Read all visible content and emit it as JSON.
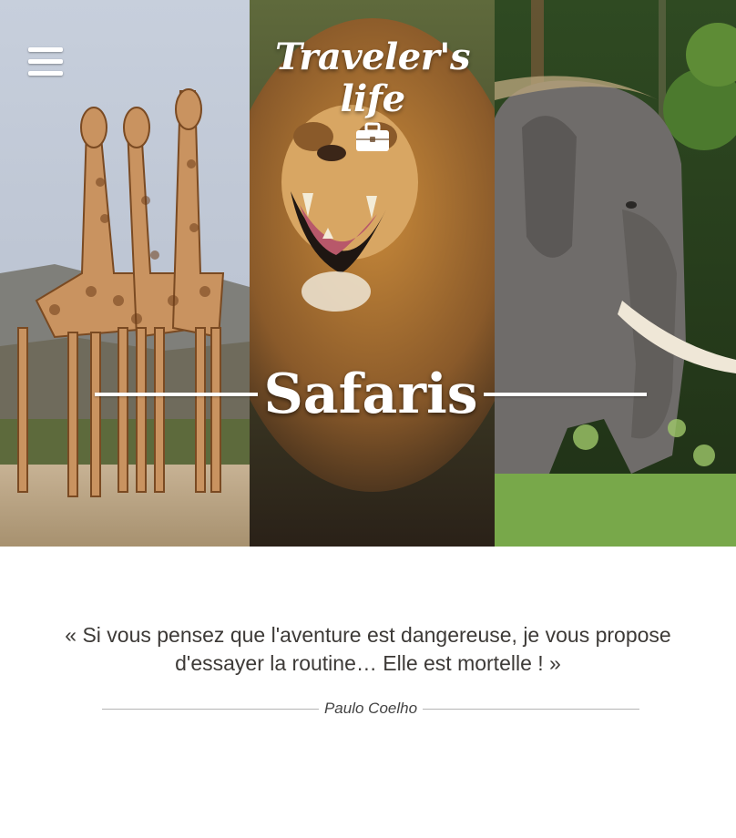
{
  "header": {
    "logo_text": "Traveler's life",
    "menu_icon": "hamburger-menu-icon",
    "logo_icon": "briefcase-icon"
  },
  "hero": {
    "title": "Safaris",
    "panels": [
      "giraffes-photo",
      "lion-photo",
      "elephant-photo"
    ]
  },
  "quote": {
    "text": "« Si vous pensez que l'aventure est dangereuse, je vous propose d'essayer la routine… Elle est mortelle ! »",
    "author": "Paulo Coelho"
  },
  "colors": {
    "text": "#3d3a37",
    "divider": "#b4b4b4",
    "overlay_text": "#ffffff"
  }
}
